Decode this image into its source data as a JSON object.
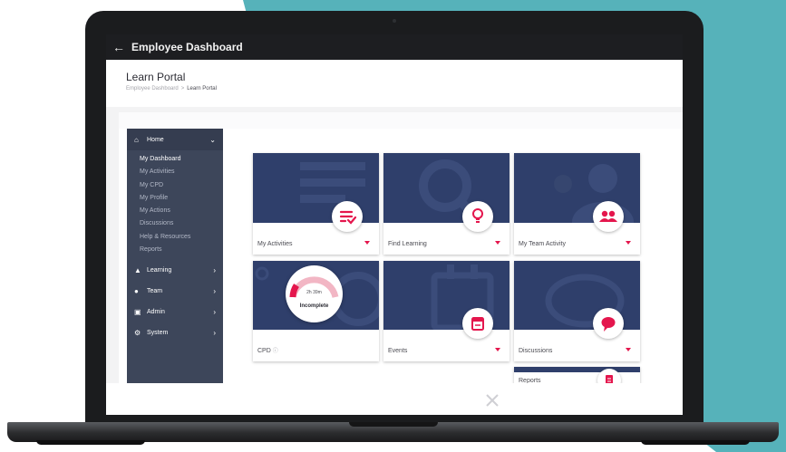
{
  "app": {
    "title": "Employee Dashboard"
  },
  "page": {
    "title": "Learn Portal",
    "breadcrumb": [
      "Employee Dashboard",
      "Learn Portal"
    ]
  },
  "sidebar": {
    "home": {
      "label": "Home",
      "items": [
        "My Dashboard",
        "My Activities",
        "My CPD",
        "My Profile",
        "My Actions",
        "Discussions",
        "Help & Resources",
        "Reports"
      ]
    },
    "sections": [
      {
        "label": "Learning",
        "icon": "graduation-cap-icon"
      },
      {
        "label": "Team",
        "icon": "group-icon"
      },
      {
        "label": "Admin",
        "icon": "clipboard-icon"
      },
      {
        "label": "System",
        "icon": "cogs-icon"
      }
    ]
  },
  "tiles": [
    {
      "label": "My Activities",
      "icon": "checklist-icon"
    },
    {
      "label": "Find Learning",
      "icon": "lightbulb-icon"
    },
    {
      "label": "My Team Activity",
      "icon": "team-icon"
    },
    {
      "label": "CPD",
      "icon": "info-icon"
    },
    {
      "label": "Events",
      "icon": "calendar-icon"
    },
    {
      "label": "Discussions",
      "icon": "chat-bubble-icon"
    },
    {
      "label": "Reports",
      "icon": "report-icon"
    }
  ],
  "cpd": {
    "time": "2h 39m",
    "status": "Incomplete",
    "progress": 0.13
  },
  "colors": {
    "accent": "#e4164d",
    "sidebar": "#3d465a",
    "tile": "#2f3f6b",
    "appbar": "#1d1e21",
    "teal": "#56b2ba"
  }
}
